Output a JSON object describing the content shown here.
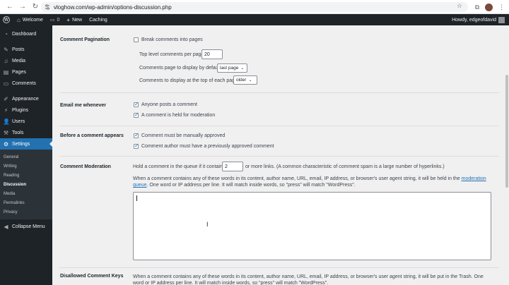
{
  "browser": {
    "url": "vloghow.com/wp-admin/options-discussion.php"
  },
  "admin_bar": {
    "site_name": "Welcome",
    "comments_count": "0",
    "new_label": "New",
    "caching_label": "Caching",
    "howdy": "Howdy, edgeofdavid"
  },
  "sidebar": {
    "items": [
      {
        "label": "Dashboard",
        "icon": "dashboard-icon"
      },
      {
        "label": "Posts",
        "icon": "pin-icon"
      },
      {
        "label": "Media",
        "icon": "media-icon"
      },
      {
        "label": "Pages",
        "icon": "pages-icon"
      },
      {
        "label": "Comments",
        "icon": "comment-icon"
      },
      {
        "label": "Appearance",
        "icon": "brush-icon"
      },
      {
        "label": "Plugins",
        "icon": "plugin-icon"
      },
      {
        "label": "Users",
        "icon": "users-icon"
      },
      {
        "label": "Tools",
        "icon": "wrench-icon"
      },
      {
        "label": "Settings",
        "icon": "settings-icon"
      }
    ],
    "submenu": [
      "General",
      "Writing",
      "Reading",
      "Discussion",
      "Media",
      "Permalinks",
      "Privacy"
    ],
    "collapse": "Collapse Menu"
  },
  "main": {
    "pagination": {
      "label": "Comment Pagination",
      "break_label": "Break comments into pages",
      "top_level_label": "Top level comments per page",
      "top_level_value": "20",
      "page_default_label": "Comments page to display by default",
      "page_default_value": "last page",
      "top_each_label": "Comments to display at the top of each page",
      "top_each_value": "older"
    },
    "email": {
      "label": "Email me whenever",
      "opt1": "Anyone posts a comment",
      "opt2": "A comment is held for moderation"
    },
    "before": {
      "label": "Before a comment appears",
      "opt1": "Comment must be manually approved",
      "opt2": "Comment author must have a previously approved comment"
    },
    "moderation": {
      "label": "Comment Moderation",
      "hold_prefix": "Hold a comment in the queue if it contains",
      "links_value": "2",
      "hold_suffix": "or more links. (A common characteristic of comment spam is a large number of hyperlinks.)",
      "desc_part1": "When a comment contains any of these words in its content, author name, URL, email, IP address, or browser's user agent string, it will be held in the",
      "desc_link": "moderation queue",
      "desc_part2": ". One word or IP address per line. It will match inside words, so \"press\" will match \"WordPress\"."
    },
    "disallowed": {
      "label": "Disallowed Comment Keys",
      "desc": "When a comment contains any of these words in its content, author name, URL, email, IP address, or browser's user agent string, it will be put in the Trash. One word or IP address per line. It will match inside words, so \"press\" will match \"WordPress\"."
    }
  }
}
